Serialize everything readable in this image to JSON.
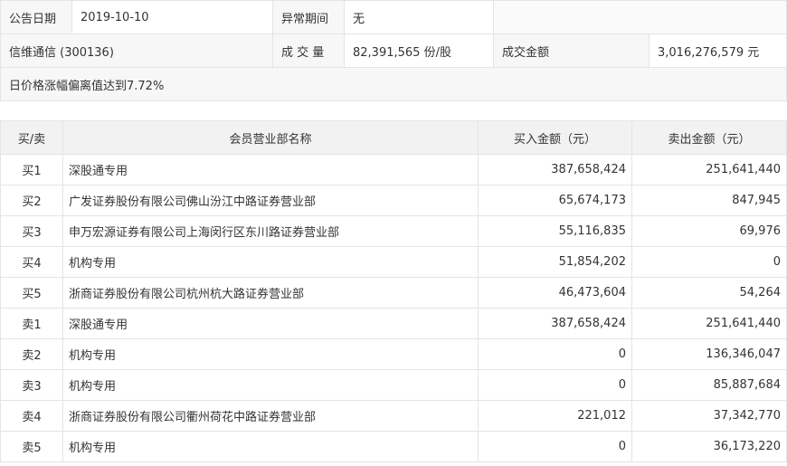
{
  "info": {
    "date_label": "公告日期",
    "date_value": "2019-10-10",
    "abnormal_label": "异常期间",
    "abnormal_value": "无",
    "stock": "信维通信 (300136)",
    "volume_label": "成 交 量",
    "volume_value": "82,391,565 份/股",
    "amount_label": "成交金额",
    "amount_value": "3,016,276,579 元",
    "reason": "日价格涨幅偏离值达到7.72%"
  },
  "table": {
    "headers": [
      "买/卖",
      "会员营业部名称",
      "买入金额（元）",
      "卖出金额（元）"
    ],
    "rows": [
      {
        "side": "买1",
        "name": "深股通专用",
        "buy": "387,658,424",
        "sell": "251,641,440"
      },
      {
        "side": "买2",
        "name": "广发证券股份有限公司佛山汾江中路证券营业部",
        "buy": "65,674,173",
        "sell": "847,945"
      },
      {
        "side": "买3",
        "name": "申万宏源证券有限公司上海闵行区东川路证券营业部",
        "buy": "55,116,835",
        "sell": "69,976"
      },
      {
        "side": "买4",
        "name": "机构专用",
        "buy": "51,854,202",
        "sell": "0"
      },
      {
        "side": "买5",
        "name": "浙商证券股份有限公司杭州杭大路证券营业部",
        "buy": "46,473,604",
        "sell": "54,264"
      },
      {
        "side": "卖1",
        "name": "深股通专用",
        "buy": "387,658,424",
        "sell": "251,641,440"
      },
      {
        "side": "卖2",
        "name": "机构专用",
        "buy": "0",
        "sell": "136,346,047"
      },
      {
        "side": "卖3",
        "name": "机构专用",
        "buy": "0",
        "sell": "85,887,684"
      },
      {
        "side": "卖4",
        "name": "浙商证券股份有限公司衢州荷花中路证券营业部",
        "buy": "221,012",
        "sell": "37,342,770"
      },
      {
        "side": "卖5",
        "name": "机构专用",
        "buy": "0",
        "sell": "36,173,220"
      }
    ]
  }
}
